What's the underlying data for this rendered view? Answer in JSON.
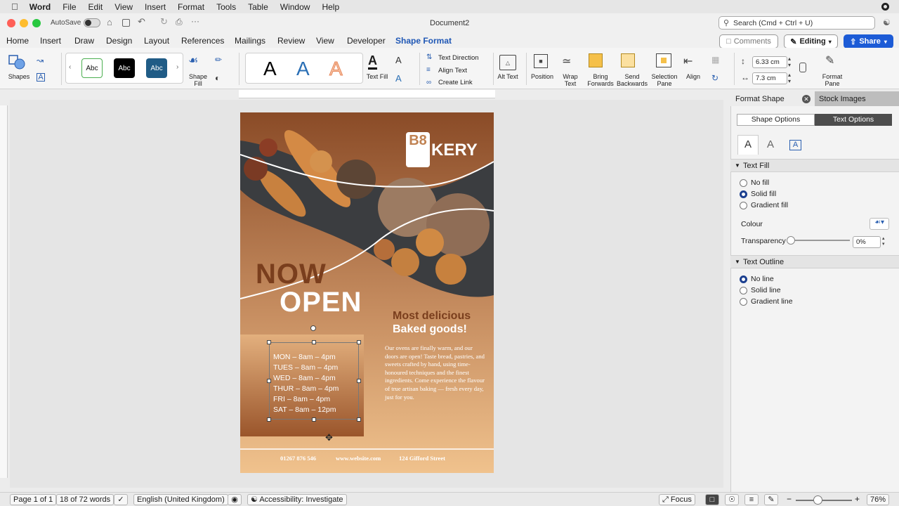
{
  "menubar": {
    "app": "Word",
    "items": [
      "File",
      "Edit",
      "View",
      "Insert",
      "Format",
      "Tools",
      "Table",
      "Window",
      "Help"
    ]
  },
  "titlebar": {
    "autosave": "AutoSave",
    "doc_title": "Document2",
    "search_placeholder": "Search (Cmd + Ctrl + U)"
  },
  "tabs": [
    "Home",
    "Insert",
    "Draw",
    "Design",
    "Layout",
    "References",
    "Mailings",
    "Review",
    "View",
    "Developer",
    "Shape Format"
  ],
  "active_tab": "Shape Format",
  "top_buttons": {
    "comments": "Comments",
    "editing": "Editing",
    "share": "Share"
  },
  "ribbon": {
    "shapes": "Shapes",
    "style_abc": "Abc",
    "shape_fill": "Shape Fill",
    "text_fill": "Text Fill",
    "text_direction": "Text Direction",
    "align_text": "Align Text",
    "create_link": "Create Link",
    "alt_text": "Alt Text",
    "position": "Position",
    "wrap_text": "Wrap Text",
    "bring_forwards": "Bring Forwards",
    "send_backwards": "Send Backwards",
    "selection_pane": "Selection Pane",
    "align": "Align",
    "height": "6.33 cm",
    "width": "7.3 cm",
    "format_pane": "Format Pane",
    "wordart_letter": "A"
  },
  "flyer": {
    "brand": "KERY",
    "brand_mark": "B8",
    "now": "NOW",
    "open": "OPEN",
    "headline1": "Most delicious",
    "headline2": "Baked goods!",
    "body": "Our ovens are finally warm, and our doors are open! Taste bread, pastries, and sweets crafted by hand, using time-honoured techniques and the finest ingredients. Come experience the flavour of true artisan baking — fresh every day, just for you.",
    "hours": [
      "MON – 8am – 4pm",
      "TUES – 8am – 4pm",
      "WED – 8am – 4pm",
      "THUR – 8am – 4pm",
      "FRI – 8am – 4pm",
      "SAT – 8am – 12pm"
    ],
    "phone": "01267 876 546",
    "website": "www.website.com",
    "address": "124 Gifford Street"
  },
  "pane": {
    "title": "Format Shape",
    "stock": "Stock Images",
    "shape_options": "Shape Options",
    "text_options": "Text Options",
    "text_fill": "Text Fill",
    "no_fill": "No fill",
    "solid_fill": "Solid fill",
    "gradient_fill": "Gradient fill",
    "colour": "Colour",
    "transparency": "Transparency",
    "transparency_value": "0%",
    "text_outline": "Text Outline",
    "no_line": "No line",
    "solid_line": "Solid line",
    "gradient_line": "Gradient line"
  },
  "status": {
    "page": "Page 1 of 1",
    "words": "18 of 72 words",
    "language": "English (United Kingdom)",
    "accessibility": "Accessibility: Investigate",
    "focus": "Focus",
    "zoom": "76%"
  },
  "colors": {
    "accent": "#1f57b5",
    "share": "#1c5bd6",
    "flyer_bg": "#c39066",
    "flyer_dark": "#7a3e1d"
  }
}
